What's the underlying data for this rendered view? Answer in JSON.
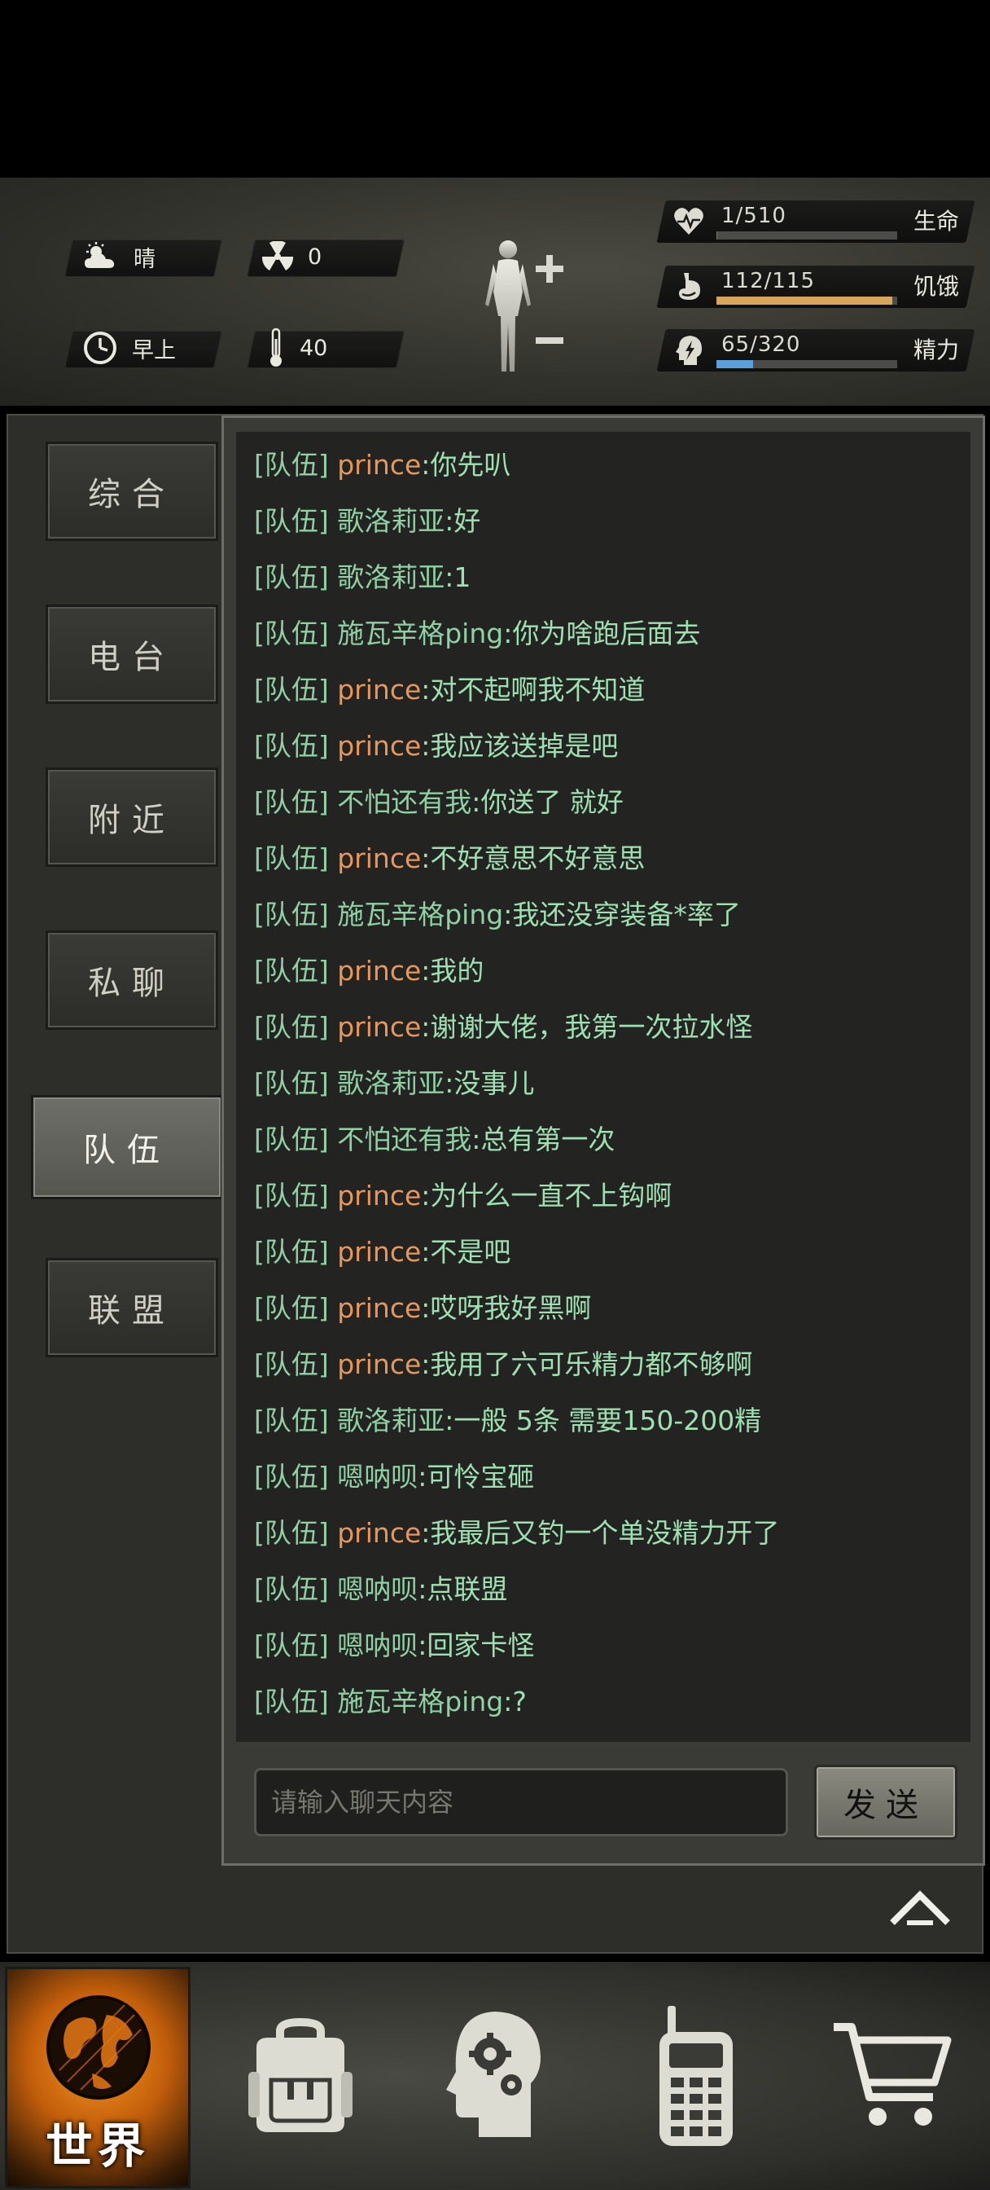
{
  "hud": {
    "weather": "晴",
    "radiation": "0",
    "time_of_day": "早上",
    "temperature": "40",
    "stats": [
      {
        "icon": "heart-pulse-icon",
        "value": "1/510",
        "label": "生命",
        "fill": 0.002,
        "color": "#7a7a72"
      },
      {
        "icon": "stomach-icon",
        "value": "112/115",
        "label": "饥饿",
        "fill": 0.974,
        "color": "#d9a55a"
      },
      {
        "icon": "head-bolt-icon",
        "value": "65/320",
        "label": "精力",
        "fill": 0.203,
        "color": "#5b9fdc"
      }
    ]
  },
  "tabs": [
    "综合",
    "电台",
    "附近",
    "私聊",
    "队伍",
    "联盟"
  ],
  "active_tab": "队伍",
  "messages": [
    {
      "channel": "[队伍]",
      "name": "prince",
      "text": "你先叭",
      "name_color": "orange"
    },
    {
      "channel": "[队伍]",
      "name": "歌洛莉亚",
      "text": "好",
      "name_color": "green"
    },
    {
      "channel": "[队伍]",
      "name": "歌洛莉亚",
      "text": "1",
      "name_color": "green"
    },
    {
      "channel": "[队伍]",
      "name": "施瓦辛格ping",
      "text": "你为啥跑后面去",
      "name_color": "green"
    },
    {
      "channel": "[队伍]",
      "name": "prince",
      "text": "对不起啊我不知道",
      "name_color": "orange"
    },
    {
      "channel": "[队伍]",
      "name": "prince",
      "text": "我应该送掉是吧",
      "name_color": "orange"
    },
    {
      "channel": "[队伍]",
      "name": "不怕还有我",
      "text": "你送了 就好",
      "name_color": "green"
    },
    {
      "channel": "[队伍]",
      "name": "prince",
      "text": "不好意思不好意思",
      "name_color": "orange"
    },
    {
      "channel": "[队伍]",
      "name": "施瓦辛格ping",
      "text": "我还没穿装备*率了",
      "name_color": "green"
    },
    {
      "channel": "[队伍]",
      "name": "prince",
      "text": "我的",
      "name_color": "orange"
    },
    {
      "channel": "[队伍]",
      "name": "prince",
      "text": "谢谢大佬，我第一次拉水怪",
      "name_color": "orange"
    },
    {
      "channel": "[队伍]",
      "name": "歌洛莉亚",
      "text": "没事儿",
      "name_color": "green"
    },
    {
      "channel": "[队伍]",
      "name": "不怕还有我",
      "text": "总有第一次",
      "name_color": "green"
    },
    {
      "channel": "[队伍]",
      "name": "prince",
      "text": "为什么一直不上钩啊",
      "name_color": "orange"
    },
    {
      "channel": "[队伍]",
      "name": "prince",
      "text": "不是吧",
      "name_color": "orange"
    },
    {
      "channel": "[队伍]",
      "name": "prince",
      "text": "哎呀我好黑啊",
      "name_color": "orange"
    },
    {
      "channel": "[队伍]",
      "name": "prince",
      "text": "我用了六可乐精力都不够啊",
      "name_color": "orange"
    },
    {
      "channel": "[队伍]",
      "name": "歌洛莉亚",
      "text": "一般 5条 需要150-200精",
      "name_color": "green"
    },
    {
      "channel": "[队伍]",
      "name": "嗯呐呗",
      "text": "可怜宝砸",
      "name_color": "green"
    },
    {
      "channel": "[队伍]",
      "name": "prince",
      "text": "我最后又钓一个单没精力开了",
      "name_color": "orange"
    },
    {
      "channel": "[队伍]",
      "name": "嗯呐呗",
      "text": "点联盟",
      "name_color": "green"
    },
    {
      "channel": "[队伍]",
      "name": "嗯呐呗",
      "text": "回家卡怪",
      "name_color": "green"
    },
    {
      "channel": "[队伍]",
      "name": "施瓦辛格ping",
      "text": "?",
      "name_color": "green"
    }
  ],
  "input": {
    "placeholder": "请输入聊天内容"
  },
  "send_label": "发送",
  "nav": {
    "world_label": "世界",
    "items": [
      "backpack-icon",
      "skills-head-icon",
      "radio-icon",
      "cart-icon"
    ]
  },
  "colors": {
    "accent_orange": "#f7951f",
    "chat_green": "#8fd0a4",
    "name_orange": "#e5975e"
  }
}
